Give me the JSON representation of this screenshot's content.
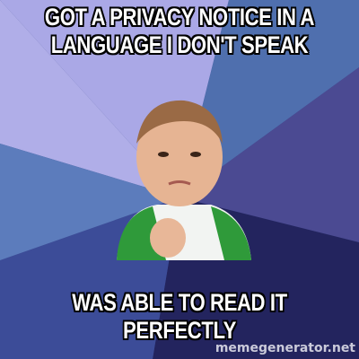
{
  "meme": {
    "top_text": "GOT A PRIVACY NOTICE IN A LANGUAGE I DON'T SPEAK",
    "bottom_text": "WAS ABLE TO READ IT PERFECTLY",
    "watermark": "memegenerator.net"
  },
  "colors": {
    "ray_light": "#aaa8e6",
    "ray_blue": "#4f6fae",
    "ray_purple": "#4b4a92",
    "ray_navy": "#23245e",
    "ray_steel": "#5c7cbc"
  }
}
